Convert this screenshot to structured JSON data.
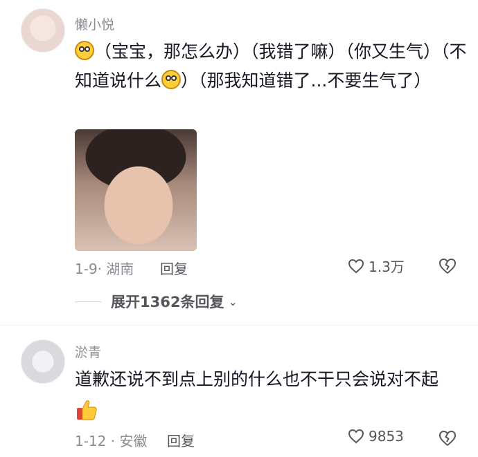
{
  "comments": [
    {
      "username": "懒小悦",
      "text_part1": "（宝宝，那怎么办）（我错了嘛）（你又生气）（不知道说什么",
      "text_part2": "）（那我知道错了...不要生气了）",
      "date_location": "1-9· 湖南",
      "reply_label": "回复",
      "likes": "1.3万",
      "has_image": true
    },
    {
      "username": "淤青",
      "text": "道歉还说不到点上别的什么也不干只会说对不起",
      "date_location": "1-12 · 安徽",
      "reply_label": "回复",
      "likes": "9853"
    }
  ],
  "expand_replies": "展开1362条回复",
  "icons": {
    "like": "heart-outline-icon",
    "dislike": "broken-heart-icon",
    "chevron": "chevron-down-icon",
    "emoji": "smiley-emoji-icon",
    "thumbs_up": "thumbs-up-emoji-icon"
  }
}
